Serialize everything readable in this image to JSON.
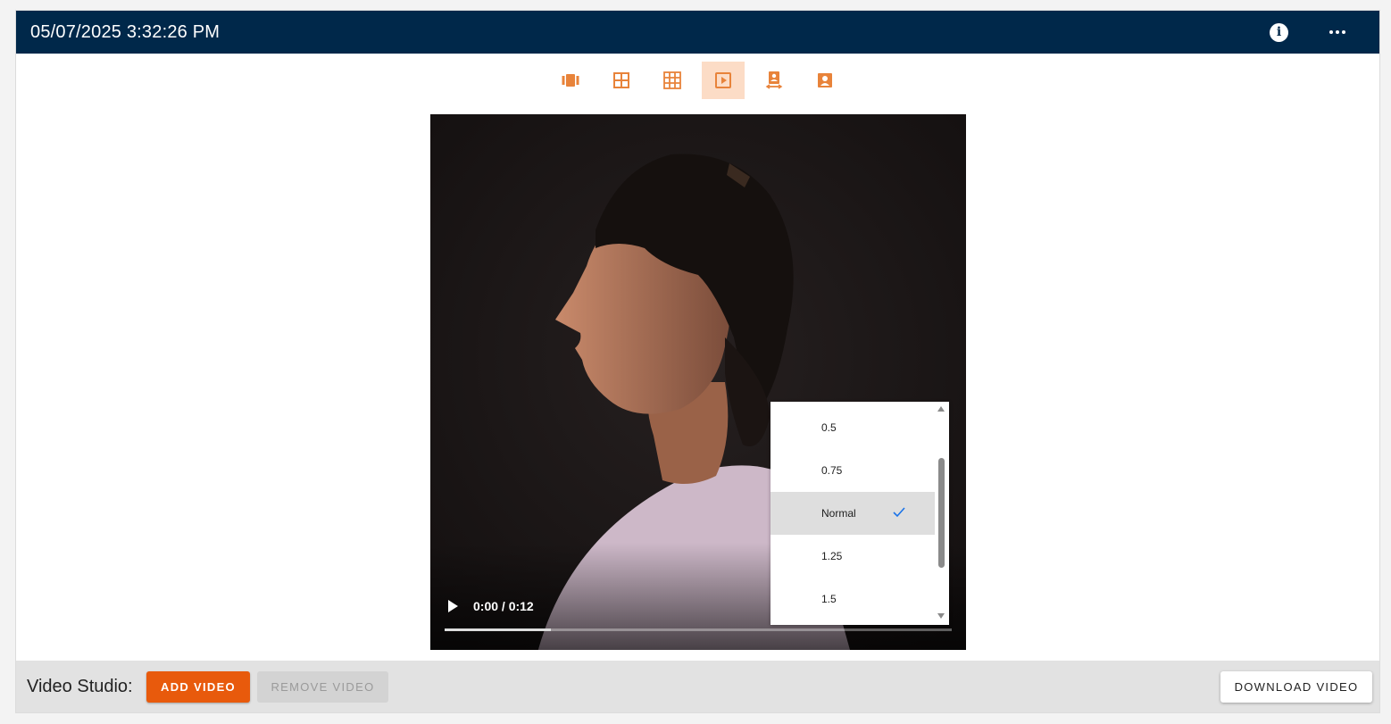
{
  "header": {
    "title": "05/07/2025 3:32:26 PM",
    "info_icon": "info-icon",
    "more_icon": "more-horizontal-icon",
    "bg_color": "#00284a"
  },
  "toolbar": {
    "accent_color": "#e8833a",
    "active_bg": "#fcdcc6",
    "tools": [
      {
        "name": "carousel-view-icon",
        "active": false
      },
      {
        "name": "grid-2x2-icon",
        "active": false
      },
      {
        "name": "grid-3x3-icon",
        "active": false
      },
      {
        "name": "video-play-icon",
        "active": true
      },
      {
        "name": "compare-portrait-icon",
        "active": false
      },
      {
        "name": "portrait-icon",
        "active": false
      }
    ]
  },
  "video": {
    "time_display": "0:00 / 0:12",
    "progress": 0.21,
    "play_icon": "play-icon"
  },
  "speed_menu": {
    "options": [
      "0.5",
      "0.75",
      "Normal",
      "1.25",
      "1.5"
    ],
    "selected": "Normal",
    "check_icon": "check-icon",
    "check_color": "#1a73e8"
  },
  "footer": {
    "label": "Video Studio:",
    "add_button": "ADD VIDEO",
    "remove_button": "REMOVE VIDEO",
    "download_button": "DOWNLOAD VIDEO",
    "add_color": "#e85a0c"
  }
}
